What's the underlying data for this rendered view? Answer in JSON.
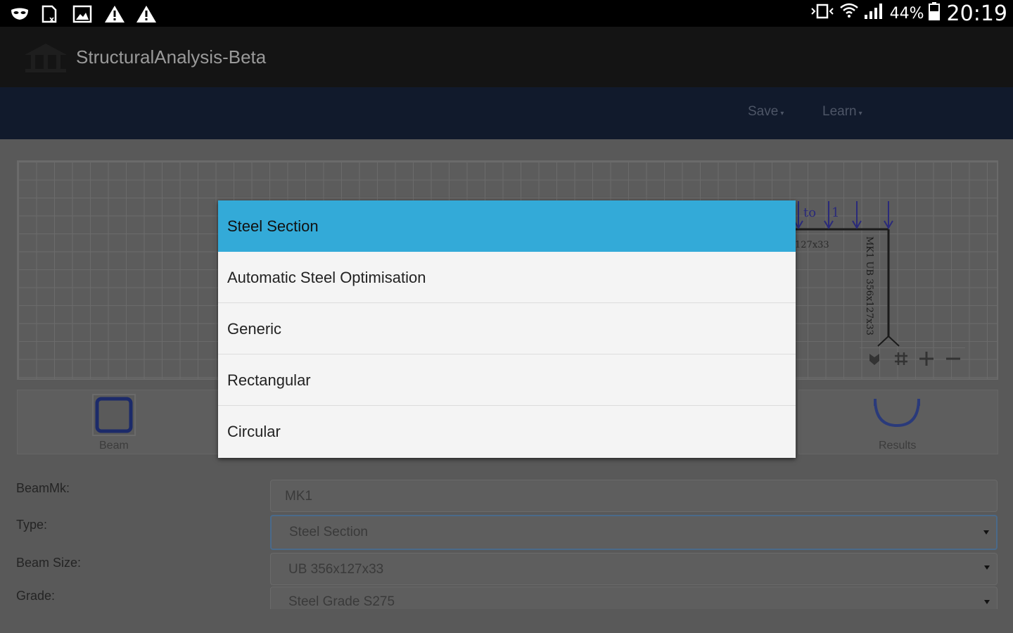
{
  "statusbar": {
    "left_icons": [
      "mask-icon",
      "excel-doc-icon",
      "image-icon",
      "warning-icon",
      "warning-icon"
    ],
    "right_icons": [
      "vibrate-icon",
      "wifi-icon",
      "signal-icon"
    ],
    "battery": "44%",
    "time": "20:19"
  },
  "app": {
    "title": "StructuralAnalysis-Beta"
  },
  "nav": {
    "save": "Save",
    "learn": "Learn"
  },
  "canvas": {
    "load_label": "to",
    "load_end": "1",
    "beam_text": "127x33",
    "column_text": "MK1 UB 356x127x33",
    "controls": [
      "settings-icon",
      "grid-icon",
      "zoom-in-icon",
      "zoom-out-icon"
    ]
  },
  "tools": {
    "beam": "Beam",
    "results": "Results"
  },
  "form": {
    "beammk_label": "BeamMk:",
    "beammk_value": "MK1",
    "type_label": "Type:",
    "type_value": "Steel Section",
    "size_label": "Beam Size:",
    "size_value": "UB 356x127x33",
    "grade_label": "Grade:",
    "grade_value": "Steel Grade S275"
  },
  "dropdown": {
    "options": [
      "Steel Section",
      "Automatic Steel Optimisation",
      "Generic",
      "Rectangular",
      "Circular"
    ],
    "selected": "Steel Section",
    "selected_color": "#33aad8"
  }
}
